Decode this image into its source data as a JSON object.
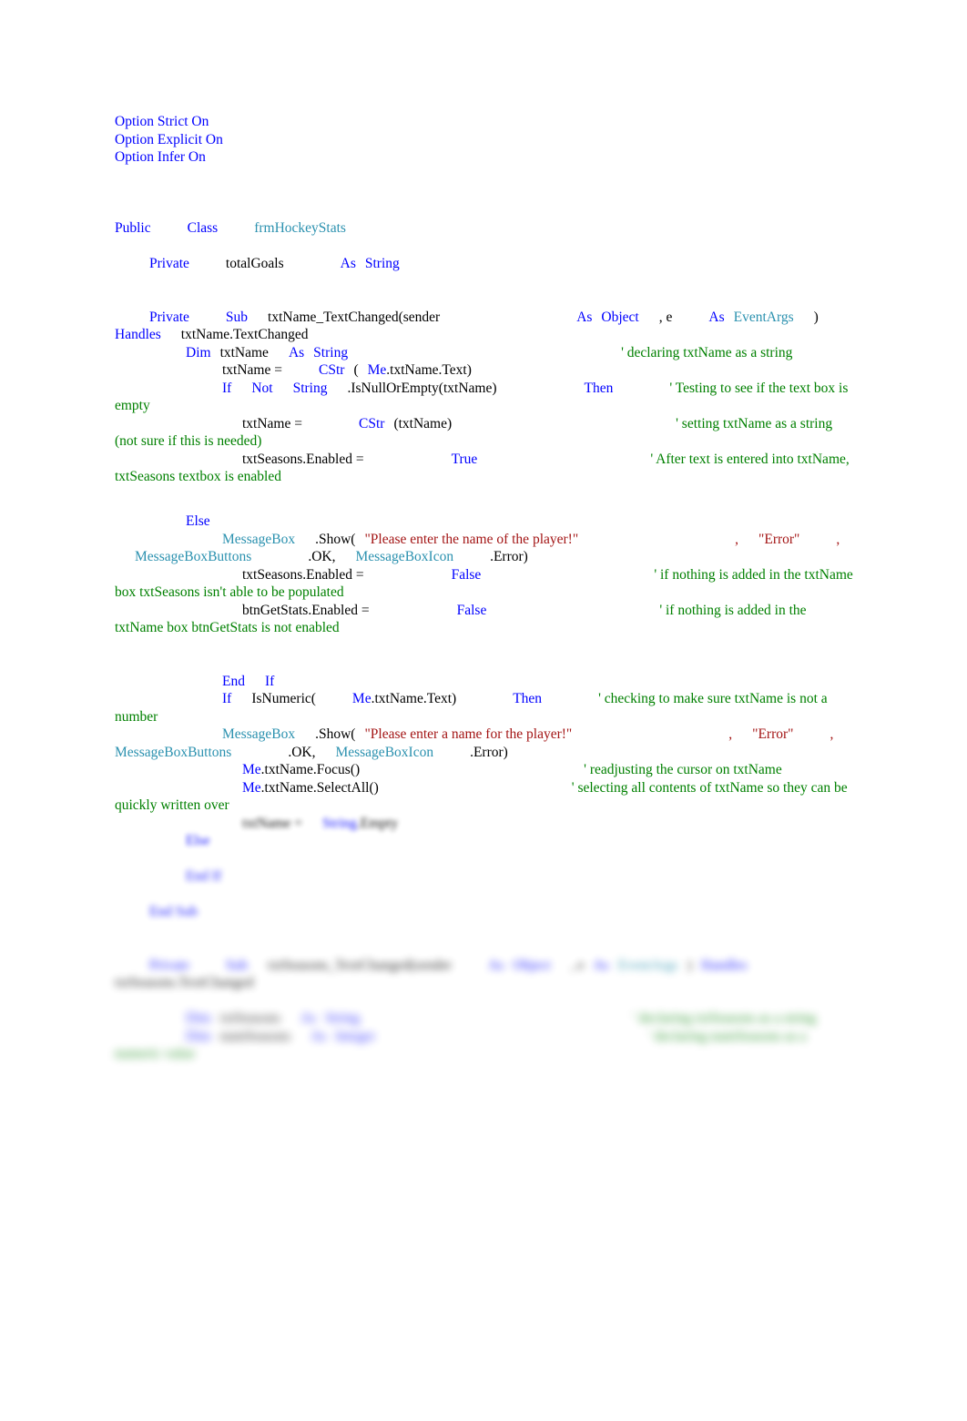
{
  "document": {
    "language": "VB.NET",
    "colors": {
      "keyword": "#0000FF",
      "type": "#2B91AF",
      "string": "#A31515",
      "comment": "#008000",
      "plain": "#000000",
      "page_background": "#FFFFFF"
    }
  },
  "options": {
    "strict": "Option Strict On",
    "explicit": "Option Explicit On",
    "infer": "Option Infer On"
  },
  "class_decl": {
    "public": "Public",
    "class": "Class",
    "name": "frmHockeyStats"
  },
  "field": {
    "private": "Private",
    "name": "totalGoals",
    "as": "As",
    "type": "String"
  },
  "sub_txtname": {
    "private": "Private",
    "sub": "Sub",
    "signature": "txtName_TextChanged(sender",
    "as1": "As",
    "type1": "Object",
    "comma_e": ", e",
    "as2": "As",
    "type2": "EventArgs",
    "close_paren": ")",
    "handles": "Handles",
    "handles_target": "txtName.TextChanged"
  },
  "lines": {
    "dim_txtname": {
      "dim": "Dim",
      "name": "txtName",
      "as": "As",
      "type": "String",
      "comment": "' declaring txtName as a string"
    },
    "assign_txtname": {
      "lhs": "txtName =",
      "cstr": "CStr",
      "open": "(",
      "me": "Me",
      "rest": ".txtName.Text)"
    },
    "if_not_null": {
      "if": "If",
      "not": "Not",
      "string": "String",
      "call": ".IsNullOrEmpty(txtName)",
      "then": "Then",
      "comment": "' Testing to see if the text box is empty"
    },
    "assign_cstr": {
      "lhs": "txtName =",
      "cstr": "CStr",
      "args": "(txtName)",
      "comment": "' setting txtName as a string (not sure if this is needed)"
    },
    "seasons_enabled_true": {
      "lhs": "txtSeasons.Enabled =",
      "value": "True",
      "comment": "' After text is entered into txtName, txtSeasons textbox is enabled"
    },
    "else": {
      "keyword": "Else"
    },
    "msgbox_name": {
      "messagebox": "MessageBox",
      "show": ".Show(",
      "message": "\"Please enter the name of the player!\"",
      "comma1": ",",
      "caption": "\"Error\"",
      "comma2": ",",
      "buttons_type": "MessageBoxButtons",
      "buttons_value": ".OK,",
      "icon_type": "MessageBoxIcon",
      "icon_value": ".Error)"
    },
    "seasons_enabled_false": {
      "lhs": "txtSeasons.Enabled =",
      "value": "False",
      "comment": "' if nothing is added in the txtName box txtSeasons isn't able to be populated"
    },
    "getstats_enabled_false": {
      "lhs": "btnGetStats.Enabled =",
      "value": "False",
      "comment": "' if nothing is added in the txtName box btnGetStats is not enabled"
    },
    "end_if": {
      "end": "End",
      "if": "If"
    },
    "if_isnumeric": {
      "if": "If",
      "call": "IsNumeric(",
      "me": "Me",
      "rest": ".txtName.Text)",
      "then": "Then",
      "comment": "' checking to make sure txtName is not a number"
    },
    "msgbox_numeric": {
      "messagebox": "MessageBox",
      "show": ".Show(",
      "message": "\"Please enter a name for the player!\"",
      "comma1": ",",
      "caption": "\"Error\"",
      "comma2": ",",
      "buttons_type": "MessageBoxButtons",
      "buttons_value": ".OK,",
      "icon_type": "MessageBoxIcon",
      "icon_value": ".Error)"
    },
    "focus": {
      "me": "Me",
      "rest": ".txtName.Focus()",
      "comment": "' readjusting the cursor on txtName"
    },
    "selectall": {
      "me": "Me",
      "rest": ".txtName.SelectAll()",
      "comment": "' selecting all contents of txtName so they can be quickly written over"
    }
  },
  "blurred": {
    "clear_line": {
      "lhs": "txtName =",
      "value": "String",
      "rest": ".Empty"
    },
    "else": "Else",
    "end_if": "End If",
    "end_sub": "End Sub",
    "sub_txtseasons": {
      "private": "Private",
      "sub": "Sub",
      "signature": "txtSeasons_TextChanged(sender",
      "as1": "As",
      "type1": "Object",
      "comma_e": ", e",
      "as2": "As",
      "type2": "EventArgs",
      "close_paren": ")",
      "handles": "Handles",
      "handles_target": "txtSeasons.TextChanged"
    },
    "dim_txtseasons": {
      "dim": "Dim",
      "name": "txtSeasons",
      "as": "As",
      "type": "String",
      "comment": "' declaring txtSeasons as a string"
    },
    "dim_numseasons": {
      "dim": "Dim",
      "name": "numSeasons",
      "as": "As",
      "type": "Integer",
      "comment": "' declaring numSeasons as a numeric value"
    }
  }
}
